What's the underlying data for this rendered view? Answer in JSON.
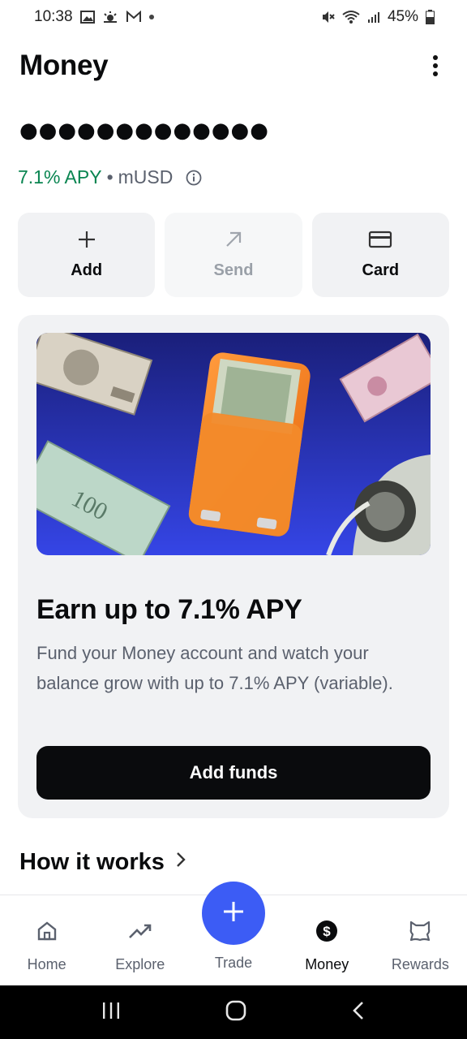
{
  "status_bar": {
    "time": "10:38",
    "battery": "45%"
  },
  "header": {
    "title": "Money"
  },
  "balance": {
    "masked": "●●●●●●●●●●●●●",
    "apy": "7.1% APY",
    "separator": "•",
    "currency": "mUSD"
  },
  "actions": [
    {
      "label": "Add",
      "icon": "plus-icon",
      "enabled": true
    },
    {
      "label": "Send",
      "icon": "send-arrow-icon",
      "enabled": false
    },
    {
      "label": "Card",
      "icon": "card-icon",
      "enabled": true
    }
  ],
  "promo": {
    "title": "Earn up to 7.1% APY",
    "description": "Fund your Money account and watch your balance grow with up to 7.1% APY (variable).",
    "button_label": "Add funds"
  },
  "section": {
    "how_it_works": "How it works"
  },
  "bottom_nav": {
    "items": [
      {
        "label": "Home",
        "icon": "home-icon"
      },
      {
        "label": "Explore",
        "icon": "trending-icon"
      },
      {
        "label": "Trade",
        "icon": "plus-icon"
      },
      {
        "label": "Money",
        "icon": "dollar-circle-icon",
        "active": true
      },
      {
        "label": "Rewards",
        "icon": "rewards-icon"
      }
    ]
  },
  "colors": {
    "accent": "#3c5cf5",
    "apy_green": "#098551",
    "primary_button": "#0a0b0d"
  }
}
